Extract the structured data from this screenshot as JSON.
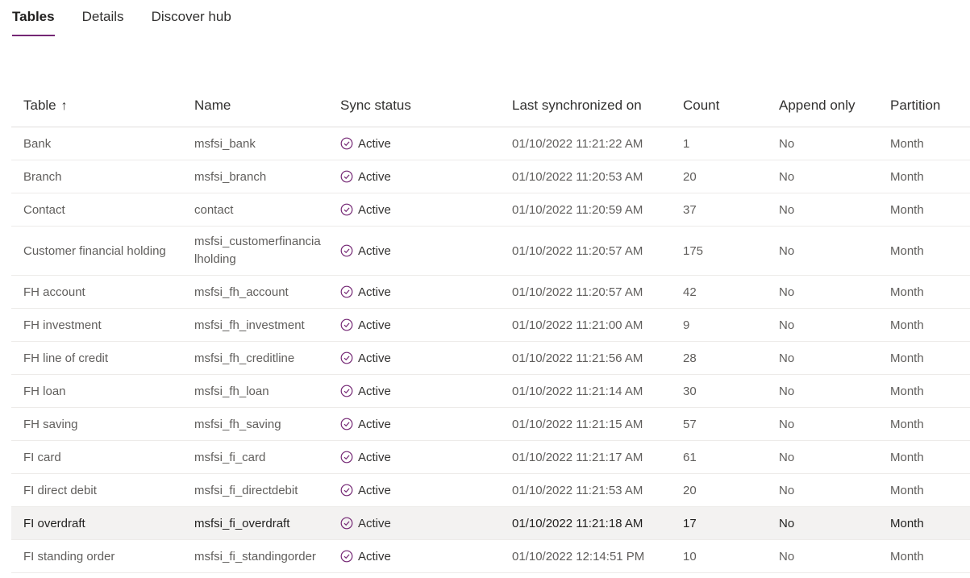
{
  "tabs": [
    {
      "label": "Tables",
      "active": true
    },
    {
      "label": "Details",
      "active": false
    },
    {
      "label": "Discover hub",
      "active": false
    }
  ],
  "columns": {
    "table": "Table",
    "table_sort_icon": "↑",
    "name": "Name",
    "sync_status": "Sync status",
    "last_sync": "Last synchronized on",
    "count": "Count",
    "append_only": "Append only",
    "partition": "Partition"
  },
  "colors": {
    "accent": "#742774",
    "status_icon": "#742774",
    "selected_row": "#f3f2f1"
  },
  "status_icon_name": "circle-check-icon",
  "rows": [
    {
      "table": "Bank",
      "name": "msfsi_bank",
      "status": "Active",
      "last_sync": "01/10/2022 11:21:22 AM",
      "count": "1",
      "append_only": "No",
      "partition": "Month"
    },
    {
      "table": "Branch",
      "name": "msfsi_branch",
      "status": "Active",
      "last_sync": "01/10/2022 11:20:53 AM",
      "count": "20",
      "append_only": "No",
      "partition": "Month"
    },
    {
      "table": "Contact",
      "name": "contact",
      "status": "Active",
      "last_sync": "01/10/2022 11:20:59 AM",
      "count": "37",
      "append_only": "No",
      "partition": "Month"
    },
    {
      "table": "Customer financial holding",
      "name": "msfsi_customerfinancialholding",
      "status": "Active",
      "last_sync": "01/10/2022 11:20:57 AM",
      "count": "175",
      "append_only": "No",
      "partition": "Month"
    },
    {
      "table": "FH account",
      "name": "msfsi_fh_account",
      "status": "Active",
      "last_sync": "01/10/2022 11:20:57 AM",
      "count": "42",
      "append_only": "No",
      "partition": "Month"
    },
    {
      "table": "FH investment",
      "name": "msfsi_fh_investment",
      "status": "Active",
      "last_sync": "01/10/2022 11:21:00 AM",
      "count": "9",
      "append_only": "No",
      "partition": "Month"
    },
    {
      "table": "FH line of credit",
      "name": "msfsi_fh_creditline",
      "status": "Active",
      "last_sync": "01/10/2022 11:21:56 AM",
      "count": "28",
      "append_only": "No",
      "partition": "Month"
    },
    {
      "table": "FH loan",
      "name": "msfsi_fh_loan",
      "status": "Active",
      "last_sync": "01/10/2022 11:21:14 AM",
      "count": "30",
      "append_only": "No",
      "partition": "Month"
    },
    {
      "table": "FH saving",
      "name": "msfsi_fh_saving",
      "status": "Active",
      "last_sync": "01/10/2022 11:21:15 AM",
      "count": "57",
      "append_only": "No",
      "partition": "Month"
    },
    {
      "table": "FI card",
      "name": "msfsi_fi_card",
      "status": "Active",
      "last_sync": "01/10/2022 11:21:17 AM",
      "count": "61",
      "append_only": "No",
      "partition": "Month"
    },
    {
      "table": "FI direct debit",
      "name": "msfsi_fi_directdebit",
      "status": "Active",
      "last_sync": "01/10/2022 11:21:53 AM",
      "count": "20",
      "append_only": "No",
      "partition": "Month"
    },
    {
      "table": "FI overdraft",
      "name": "msfsi_fi_overdraft",
      "status": "Active",
      "last_sync": "01/10/2022 11:21:18 AM",
      "count": "17",
      "append_only": "No",
      "partition": "Month",
      "selected": true
    },
    {
      "table": "FI standing order",
      "name": "msfsi_fi_standingorder",
      "status": "Active",
      "last_sync": "01/10/2022 12:14:51 PM",
      "count": "10",
      "append_only": "No",
      "partition": "Month"
    }
  ]
}
